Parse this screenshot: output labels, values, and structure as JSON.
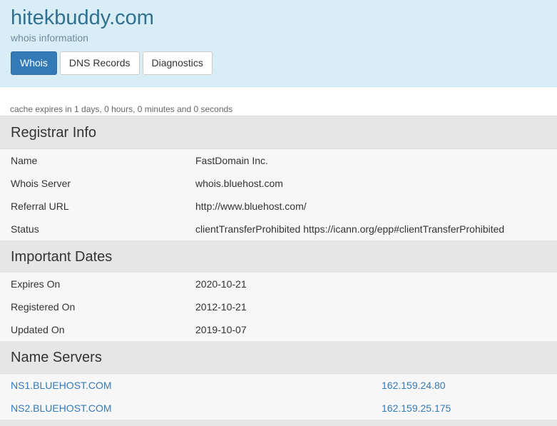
{
  "header": {
    "domain": "hitekbuddy.com",
    "subtitle": "whois information",
    "tabs": [
      {
        "label": "Whois",
        "active": true
      },
      {
        "label": "DNS Records",
        "active": false
      },
      {
        "label": "Diagnostics",
        "active": false
      }
    ]
  },
  "cache_note": "cache expires in 1 days, 0 hours, 0 minutes and 0 seconds",
  "registrar": {
    "title": "Registrar Info",
    "rows": [
      {
        "key": "Name",
        "value": "FastDomain Inc."
      },
      {
        "key": "Whois Server",
        "value": "whois.bluehost.com"
      },
      {
        "key": "Referral URL",
        "value": "http://www.bluehost.com/"
      },
      {
        "key": "Status",
        "value": "clientTransferProhibited https://icann.org/epp#clientTransferProhibited"
      }
    ]
  },
  "dates": {
    "title": "Important Dates",
    "rows": [
      {
        "key": "Expires On",
        "value": "2020-10-21"
      },
      {
        "key": "Registered On",
        "value": "2012-10-21"
      },
      {
        "key": "Updated On",
        "value": "2019-10-07"
      }
    ]
  },
  "nameservers": {
    "title": "Name Servers",
    "rows": [
      {
        "host": "NS1.BLUEHOST.COM",
        "ip": "162.159.24.80"
      },
      {
        "host": "NS2.BLUEHOST.COM",
        "ip": "162.159.25.175"
      }
    ]
  },
  "colors": {
    "header_bg": "#d9edf7",
    "title_color": "#31708f",
    "accent": "#337ab7",
    "section_bg": "#e6e6e6",
    "row_bg": "#f7f7f7"
  }
}
